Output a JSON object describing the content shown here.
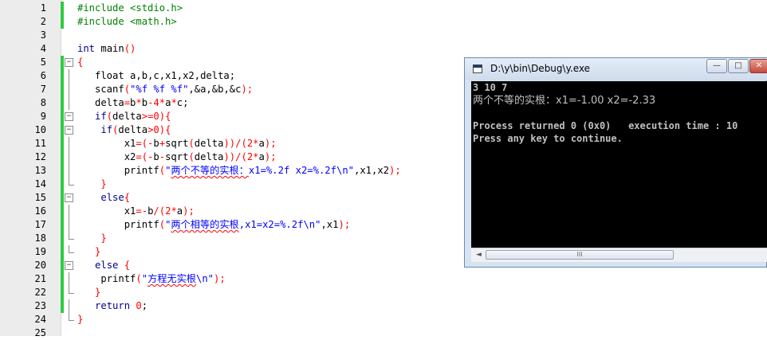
{
  "editor": {
    "lines": [
      {
        "n": "1",
        "fold": "none",
        "changed": true,
        "code": [
          {
            "t": "#include <stdio.h>",
            "c": "pp"
          }
        ]
      },
      {
        "n": "2",
        "fold": "none",
        "changed": true,
        "code": [
          {
            "t": "#include <math.h>",
            "c": "pp"
          }
        ]
      },
      {
        "n": "3",
        "fold": "none",
        "changed": false,
        "code": []
      },
      {
        "n": "4",
        "fold": "none",
        "changed": false,
        "code": [
          {
            "t": "int",
            "c": "kw"
          },
          {
            "t": " main"
          },
          {
            "t": "()",
            "c": "op"
          }
        ]
      },
      {
        "n": "5",
        "fold": "open",
        "changed": true,
        "code": [
          {
            "t": "{",
            "c": "op"
          }
        ]
      },
      {
        "n": "6",
        "fold": "line",
        "changed": true,
        "code": [
          {
            "t": "   float a,b,c,x1,x2,delta;"
          }
        ]
      },
      {
        "n": "7",
        "fold": "line",
        "changed": true,
        "code": [
          {
            "t": "   scanf"
          },
          {
            "t": "(",
            "c": "op"
          },
          {
            "t": "\"%f %f %f\"",
            "c": "str"
          },
          {
            "t": ",&a,&b,&c"
          },
          {
            "t": ");",
            "c": "op"
          }
        ]
      },
      {
        "n": "8",
        "fold": "line",
        "changed": true,
        "code": [
          {
            "t": "   delta"
          },
          {
            "t": "=",
            "c": "op"
          },
          {
            "t": "b"
          },
          {
            "t": "*",
            "c": "op"
          },
          {
            "t": "b"
          },
          {
            "t": "-",
            "c": "op"
          },
          {
            "t": "4",
            "c": "num"
          },
          {
            "t": "*",
            "c": "op"
          },
          {
            "t": "a"
          },
          {
            "t": "*",
            "c": "op"
          },
          {
            "t": "c;"
          }
        ]
      },
      {
        "n": "9",
        "fold": "open",
        "changed": true,
        "code": [
          {
            "t": "   "
          },
          {
            "t": "if",
            "c": "kw"
          },
          {
            "t": "(",
            "c": "op"
          },
          {
            "t": "delta"
          },
          {
            "t": ">=",
            "c": "op"
          },
          {
            "t": "0",
            "c": "num"
          },
          {
            "t": "){",
            "c": "op"
          }
        ]
      },
      {
        "n": "10",
        "fold": "open",
        "changed": true,
        "code": [
          {
            "t": "    "
          },
          {
            "t": "if",
            "c": "kw"
          },
          {
            "t": "(",
            "c": "op"
          },
          {
            "t": "delta"
          },
          {
            "t": ">",
            "c": "op"
          },
          {
            "t": "0",
            "c": "num"
          },
          {
            "t": "){",
            "c": "op"
          }
        ]
      },
      {
        "n": "11",
        "fold": "line",
        "changed": true,
        "code": [
          {
            "t": "        x1"
          },
          {
            "t": "=(-",
            "c": "op"
          },
          {
            "t": "b"
          },
          {
            "t": "+",
            "c": "op"
          },
          {
            "t": "sqrt"
          },
          {
            "t": "(",
            "c": "op"
          },
          {
            "t": "delta"
          },
          {
            "t": "))/(",
            "c": "op"
          },
          {
            "t": "2",
            "c": "num"
          },
          {
            "t": "*",
            "c": "op"
          },
          {
            "t": "a"
          },
          {
            "t": ");",
            "c": "op"
          }
        ]
      },
      {
        "n": "12",
        "fold": "line",
        "changed": true,
        "code": [
          {
            "t": "        x2"
          },
          {
            "t": "=(-",
            "c": "op"
          },
          {
            "t": "b"
          },
          {
            "t": "-",
            "c": "op"
          },
          {
            "t": "sqrt"
          },
          {
            "t": "(",
            "c": "op"
          },
          {
            "t": "delta"
          },
          {
            "t": "))/(",
            "c": "op"
          },
          {
            "t": "2",
            "c": "num"
          },
          {
            "t": "*",
            "c": "op"
          },
          {
            "t": "a"
          },
          {
            "t": ");",
            "c": "op"
          }
        ]
      },
      {
        "n": "13",
        "fold": "line",
        "changed": true,
        "code": [
          {
            "t": "        printf"
          },
          {
            "t": "(",
            "c": "op"
          },
          {
            "t": "\"",
            "c": "str"
          },
          {
            "t": "两个不等的实根：",
            "c": "str",
            "sq": true
          },
          {
            "t": "x1=%.2f x2=%.2f\\n\"",
            "c": "str"
          },
          {
            "t": ",x1,x2"
          },
          {
            "t": ");",
            "c": "op"
          }
        ]
      },
      {
        "n": "14",
        "fold": "end",
        "changed": true,
        "code": [
          {
            "t": "    }",
            "c": "op"
          }
        ]
      },
      {
        "n": "15",
        "fold": "open",
        "changed": true,
        "code": [
          {
            "t": "    "
          },
          {
            "t": "else",
            "c": "kw"
          },
          {
            "t": "{",
            "c": "op"
          }
        ]
      },
      {
        "n": "16",
        "fold": "line",
        "changed": true,
        "code": [
          {
            "t": "        x1"
          },
          {
            "t": "=-",
            "c": "op"
          },
          {
            "t": "b"
          },
          {
            "t": "/(",
            "c": "op"
          },
          {
            "t": "2",
            "c": "num"
          },
          {
            "t": "*",
            "c": "op"
          },
          {
            "t": "a"
          },
          {
            "t": ");",
            "c": "op"
          }
        ]
      },
      {
        "n": "17",
        "fold": "line",
        "changed": true,
        "code": [
          {
            "t": "        printf"
          },
          {
            "t": "(",
            "c": "op"
          },
          {
            "t": "\"",
            "c": "str"
          },
          {
            "t": "两个相等的实根",
            "c": "str",
            "sq": true
          },
          {
            "t": ",x1=x2=%.2f\\n\"",
            "c": "str"
          },
          {
            "t": ",x1"
          },
          {
            "t": ");",
            "c": "op"
          }
        ]
      },
      {
        "n": "18",
        "fold": "end",
        "changed": true,
        "code": [
          {
            "t": "    }",
            "c": "op"
          }
        ]
      },
      {
        "n": "19",
        "fold": "end",
        "changed": true,
        "code": [
          {
            "t": "   }",
            "c": "op"
          }
        ]
      },
      {
        "n": "20",
        "fold": "open",
        "changed": true,
        "code": [
          {
            "t": "   "
          },
          {
            "t": "else",
            "c": "kw"
          },
          {
            "t": " "
          },
          {
            "t": "{",
            "c": "op"
          }
        ]
      },
      {
        "n": "21",
        "fold": "line",
        "changed": true,
        "code": [
          {
            "t": "    printf"
          },
          {
            "t": "(",
            "c": "op"
          },
          {
            "t": "\"",
            "c": "str"
          },
          {
            "t": "方程无实根",
            "c": "str",
            "sq": true
          },
          {
            "t": "\\n\"",
            "c": "str"
          },
          {
            "t": ");",
            "c": "op"
          }
        ]
      },
      {
        "n": "22",
        "fold": "end",
        "changed": true,
        "code": [
          {
            "t": "   }",
            "c": "op"
          }
        ]
      },
      {
        "n": "23",
        "fold": "line",
        "changed": true,
        "code": [
          {
            "t": "   "
          },
          {
            "t": "return",
            "c": "kw"
          },
          {
            "t": " "
          },
          {
            "t": "0",
            "c": "num"
          },
          {
            "t": ";"
          }
        ]
      },
      {
        "n": "24",
        "fold": "end",
        "changed": false,
        "code": [
          {
            "t": "}",
            "c": "op"
          }
        ]
      },
      {
        "n": "25",
        "fold": "none",
        "changed": false,
        "code": []
      }
    ]
  },
  "console": {
    "title": "D:\\y\\bin\\Debug\\y.exe",
    "min_label": "—",
    "max_label": "□",
    "close_label": "✕",
    "scroll_left": "◄",
    "scroll_thumb": "III",
    "output": [
      {
        "text": "3 10 7",
        "cjk": false
      },
      {
        "text": "两个不等的实根：x1=-1.00 x2=-2.33",
        "cjk": true
      },
      {
        "text": "",
        "cjk": false
      },
      {
        "text": "Process returned 0 (0x0)   execution time : 10",
        "cjk": false
      },
      {
        "text": "Press any key to continue.",
        "cjk": false
      }
    ]
  },
  "colors": {
    "preprocessor": "#008000",
    "keyword": "#00008b",
    "number": "#ff0000",
    "string": "#0000ff",
    "change_bar": "#2ecc40",
    "console_bg": "#000000",
    "console_fg": "#c0c0c0"
  }
}
